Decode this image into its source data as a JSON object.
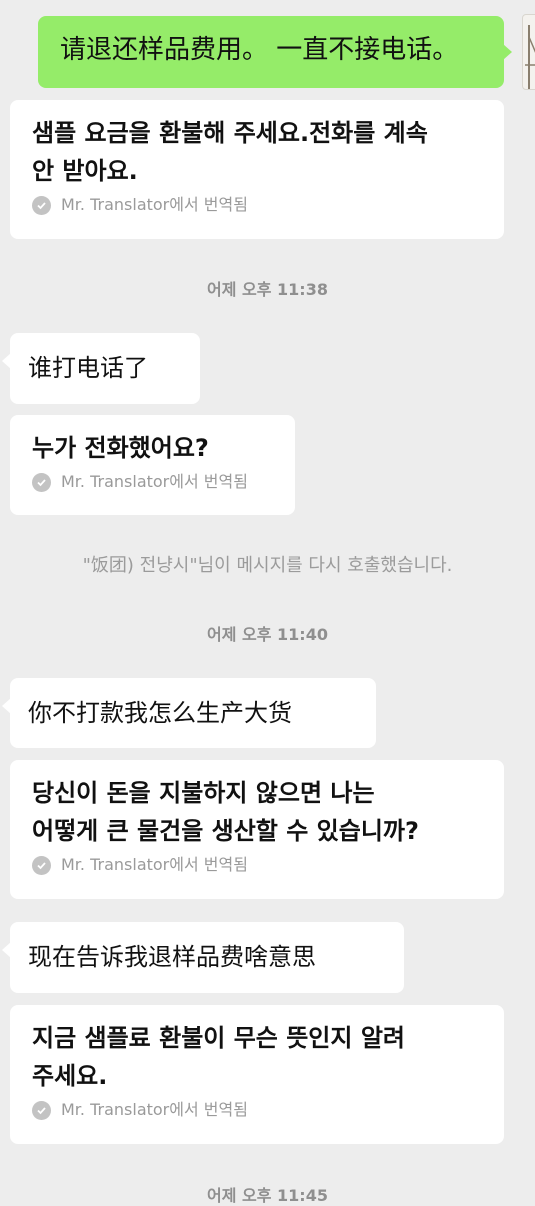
{
  "messages": [
    {
      "id": "m1",
      "text": "请退还样品费用。 一直不接电话。"
    },
    {
      "id": "t1",
      "text": "샘플 요금을 환불해 주세요.전화를 계속\n안 받아요.",
      "footer": "Mr. Translator에서 번역됨"
    },
    {
      "id": "m2",
      "text": "谁打电话了"
    },
    {
      "id": "t2",
      "text": "누가 전화했어요?",
      "footer": "Mr. Translator에서 번역됨"
    },
    {
      "id": "m3",
      "text": "你不打款我怎么生产大货"
    },
    {
      "id": "t3",
      "text": "당신이 돈을 지불하지 않으면 나는\n어떻게 큰 물건을 생산할 수 있습니까?",
      "footer": "Mr. Translator에서 번역됨"
    },
    {
      "id": "m4",
      "text": "现在告诉我退样品费啥意思"
    },
    {
      "id": "t4",
      "text": "지금 샘플료 환불이 무슨 뜻인지 알려\n주세요.",
      "footer": "Mr. Translator에서 번역됨"
    }
  ],
  "timestamps": [
    "어제 오후 11:38",
    "어제 오후 11:40",
    "어제 오후 11:45"
  ],
  "system_notice": "\"饭团) 전냥시\"님이 메시지를 다시 호출했습니다.",
  "colors": {
    "background": "#ededed",
    "sent_bubble": "#95ec69",
    "received_bubble": "#ffffff",
    "muted_text": "#9a9a9a"
  },
  "icons": {
    "translated": "check-circle-icon",
    "avatar": "user-avatar"
  }
}
